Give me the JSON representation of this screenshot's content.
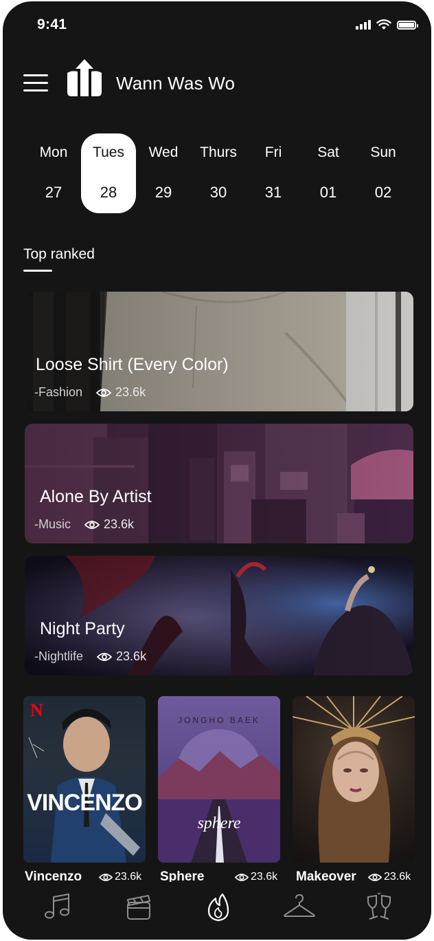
{
  "status_bar": {
    "time": "9:41"
  },
  "header": {
    "title": "Wann Was Wo",
    "menu_icon": "hamburger-icon",
    "logo_icon": "logo-icon"
  },
  "days": [
    {
      "name": "Mon",
      "num": "27",
      "selected": false
    },
    {
      "name": "Tues",
      "num": "28",
      "selected": true
    },
    {
      "name": "Wed",
      "num": "29",
      "selected": false
    },
    {
      "name": "Thurs",
      "num": "30",
      "selected": false
    },
    {
      "name": "Fri",
      "num": "31",
      "selected": false
    },
    {
      "name": "Sat",
      "num": "01",
      "selected": false
    },
    {
      "name": "Sun",
      "num": "02",
      "selected": false
    }
  ],
  "section": {
    "label": "Top ranked"
  },
  "cards": [
    {
      "title": "Loose Shirt (Every Color)",
      "category": "-Fashion",
      "views": "23.6k"
    },
    {
      "title": "Alone By Artist",
      "category": "-Music",
      "views": "23.6k"
    },
    {
      "title": "Night Party",
      "category": "-Nightlife",
      "views": "23.6k"
    }
  ],
  "posters": [
    {
      "label": "Vincenzo",
      "views": "23.6k",
      "art_text": "VINCENZO",
      "badge": "N"
    },
    {
      "label": "Sphere",
      "views": "23.6k",
      "art_text": "sphere",
      "art_top": "JONGHO BAEK"
    },
    {
      "label": "Makeover",
      "views": "23.6k"
    }
  ],
  "bottom_nav": [
    {
      "icon": "music-note-icon",
      "active": false
    },
    {
      "icon": "clapperboard-icon",
      "active": false
    },
    {
      "icon": "flame-icon",
      "active": true
    },
    {
      "icon": "hanger-icon",
      "active": false
    },
    {
      "icon": "champagne-glasses-icon",
      "active": false
    }
  ],
  "colors": {
    "background": "#151516",
    "text": "#ffffff",
    "selected_bg": "#ffffff"
  }
}
